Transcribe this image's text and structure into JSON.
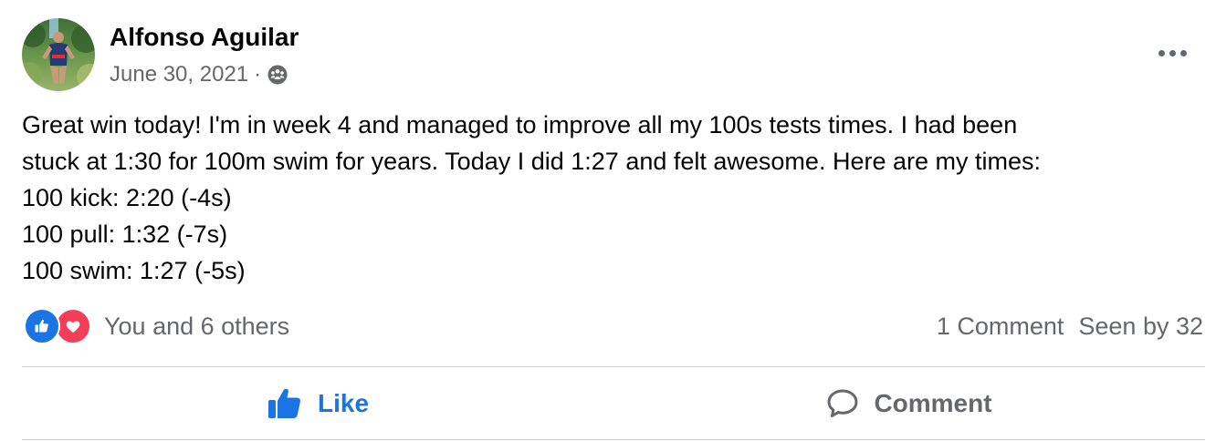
{
  "author": {
    "name": "Alfonso Aguilar"
  },
  "meta": {
    "date": "June 30, 2021",
    "separator": "·",
    "privacy_icon": "group-icon"
  },
  "post": {
    "lines": [
      "Great win today! I'm in week 4 and managed to improve all my 100s tests times. I had been",
      "stuck at 1:30 for 100m swim for years. Today I did 1:27 and felt awesome. Here are my times:",
      "100 kick: 2:20 (-4s)",
      "100 pull: 1:32 (-7s)",
      "100 swim: 1:27 (-5s)"
    ]
  },
  "reactions": {
    "icons": [
      "like-icon",
      "love-icon"
    ],
    "text": "You and 6 others"
  },
  "stats": {
    "comments": "1 Comment",
    "seen_by": "Seen by 32"
  },
  "actions": {
    "like_label": "Like",
    "comment_label": "Comment"
  },
  "colors": {
    "accent": "#1b74e4",
    "love": "#f33e58",
    "secondary_text": "#65676b",
    "primary_text": "#050505",
    "divider": "#ced0d4"
  }
}
